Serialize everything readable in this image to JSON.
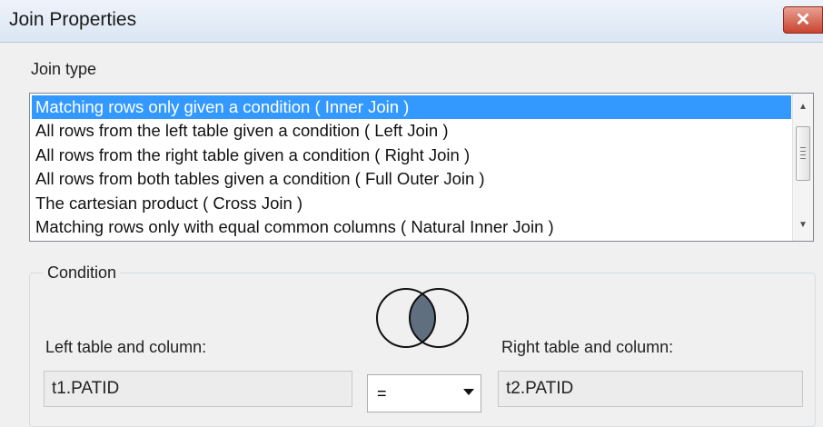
{
  "window": {
    "title": "Join Properties",
    "close_label": "✕"
  },
  "join_type": {
    "label": "Join type",
    "options": [
      "Matching rows only given a condition ( Inner Join )",
      "All rows from the left table given a condition ( Left Join )",
      "All rows from the right table given a condition ( Right Join )",
      "All rows from both tables given a condition ( Full Outer Join )",
      "The cartesian product ( Cross Join )",
      "Matching rows only with equal common columns ( Natural Inner Join )"
    ],
    "selected_index": 0
  },
  "condition": {
    "legend": "Condition",
    "left_label": "Left table and column:",
    "left_value": "t1.PATID",
    "operator": "=",
    "right_label": "Right table and column:",
    "right_value": "t2.PATID",
    "venn_icon": "inner-join-venn-icon"
  },
  "colors": {
    "selection": "#3399ff",
    "venn_overlap": "#5f6f7f",
    "close_button": "#c9432f"
  }
}
